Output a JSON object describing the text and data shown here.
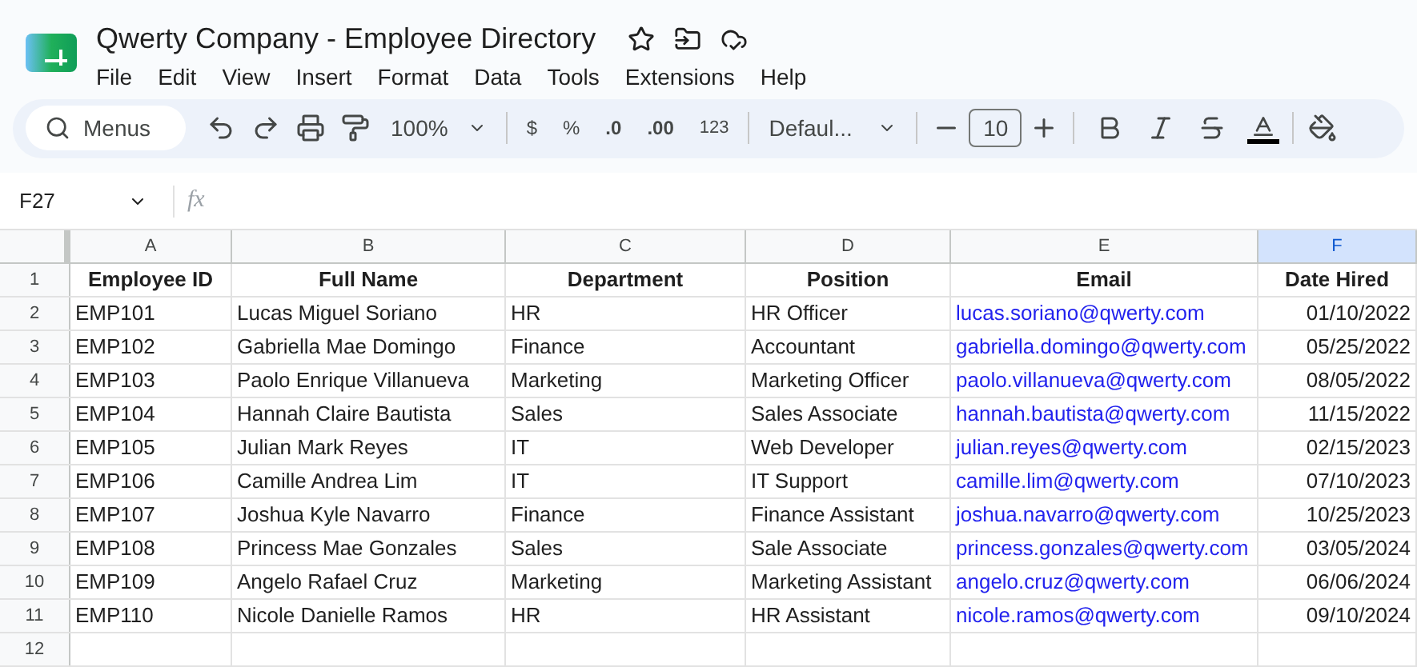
{
  "document": {
    "title": "Qwerty Company - Employee Directory"
  },
  "menu": [
    "File",
    "Edit",
    "View",
    "Insert",
    "Format",
    "Data",
    "Tools",
    "Extensions",
    "Help"
  ],
  "toolbar": {
    "search": "Menus",
    "zoom": "100%",
    "currency": "$",
    "percent": "%",
    "decrease_decimal": ".0",
    "increase_decimal": ".00",
    "number_format": "123",
    "font": "Defaul...",
    "font_size": "10"
  },
  "formula_bar": {
    "cell_ref": "F27",
    "function_label": "fx"
  },
  "columns": [
    {
      "label": "A",
      "kind": "text",
      "selected": false
    },
    {
      "label": "B",
      "kind": "text",
      "selected": false
    },
    {
      "label": "C",
      "kind": "text",
      "selected": false
    },
    {
      "label": "D",
      "kind": "text",
      "selected": false
    },
    {
      "label": "E",
      "kind": "link",
      "selected": false
    },
    {
      "label": "F",
      "kind": "date",
      "selected": true
    }
  ],
  "header_row": {
    "number": "1",
    "cells": [
      "Employee ID",
      "Full Name",
      "Department",
      "Position",
      "Email",
      "Date Hired"
    ]
  },
  "rows": [
    {
      "number": "2",
      "cells": [
        "EMP101",
        "Lucas Miguel Soriano",
        "HR",
        "HR Officer",
        "lucas.soriano@qwerty.com",
        "01/10/2022"
      ]
    },
    {
      "number": "3",
      "cells": [
        "EMP102",
        "Gabriella Mae Domingo",
        "Finance",
        "Accountant",
        "gabriella.domingo@qwerty.com",
        "05/25/2022"
      ]
    },
    {
      "number": "4",
      "cells": [
        "EMP103",
        "Paolo Enrique Villanueva",
        "Marketing",
        "Marketing Officer",
        "paolo.villanueva@qwerty.com",
        "08/05/2022"
      ]
    },
    {
      "number": "5",
      "cells": [
        "EMP104",
        "Hannah Claire Bautista",
        "Sales",
        "Sales Associate",
        "hannah.bautista@qwerty.com",
        "11/15/2022"
      ]
    },
    {
      "number": "6",
      "cells": [
        "EMP105",
        "Julian Mark Reyes",
        "IT",
        "Web Developer",
        "julian.reyes@qwerty.com",
        "02/15/2023"
      ]
    },
    {
      "number": "7",
      "cells": [
        "EMP106",
        "Camille Andrea Lim",
        "IT",
        "IT Support",
        "camille.lim@qwerty.com",
        "07/10/2023"
      ]
    },
    {
      "number": "8",
      "cells": [
        "EMP107",
        "Joshua Kyle Navarro",
        "Finance",
        "Finance Assistant",
        "joshua.navarro@qwerty.com",
        "10/25/2023"
      ]
    },
    {
      "number": "9",
      "cells": [
        "EMP108",
        "Princess Mae Gonzales",
        "Sales",
        "Sale Associate",
        "princess.gonzales@qwerty.com",
        "03/05/2024"
      ]
    },
    {
      "number": "10",
      "cells": [
        "EMP109",
        "Angelo Rafael Cruz",
        "Marketing",
        "Marketing Assistant",
        "angelo.cruz@qwerty.com",
        "06/06/2024"
      ]
    },
    {
      "number": "11",
      "cells": [
        "EMP110",
        "Nicole Danielle Ramos",
        "HR",
        "HR Assistant",
        "nicole.ramos@qwerty.com",
        "09/10/2024"
      ]
    },
    {
      "number": "12"
    }
  ]
}
